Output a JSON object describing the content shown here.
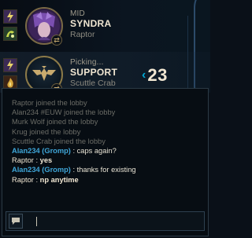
{
  "slot1": {
    "role": "MID",
    "champion": "SYNDRA",
    "player": "Raptor"
  },
  "slot2": {
    "role": "Picking...",
    "champion": "SUPPORT",
    "player": "Scuttle Crab"
  },
  "timer": {
    "chevron": "‹",
    "seconds": "23"
  },
  "chat": {
    "messages": [
      {
        "type": "system",
        "text": "Raptor joined the lobby"
      },
      {
        "type": "system",
        "text": "Alan234 #EUW joined the lobby"
      },
      {
        "type": "system",
        "text": "Murk Wolf joined the lobby"
      },
      {
        "type": "system",
        "text": "Krug joined the lobby"
      },
      {
        "type": "system",
        "text": "Scuttle Crab joined the lobby"
      },
      {
        "type": "chat",
        "speaker": "Alan234 (Gromp)",
        "sep": " : ",
        "text": "caps again?"
      },
      {
        "type": "chat",
        "speaker": "Raptor",
        "sep": " : ",
        "text": "yes"
      },
      {
        "type": "chat",
        "speaker": "Alan234 (Gromp)",
        "sep": " : ",
        "text": "thanks for existing"
      },
      {
        "type": "chat",
        "speaker": "Raptor",
        "sep": " : ",
        "text": "np anytime"
      }
    ],
    "input_value": ""
  },
  "colors": {
    "gold": "#c8aa6e",
    "accent_blue": "#00a8d4",
    "speaker_blue": "#3fa6d8",
    "system_text": "#6b6c66"
  },
  "icons": {
    "spell1a": "flash-spell-icon",
    "spell1b": "teleport-spell-icon",
    "spell2a": "flash-spell-icon",
    "spell2b": "ignite-spell-icon",
    "support_role": "support-role-icon",
    "swap": "swap-icon",
    "chat_button": "chat-bubble-icon"
  }
}
